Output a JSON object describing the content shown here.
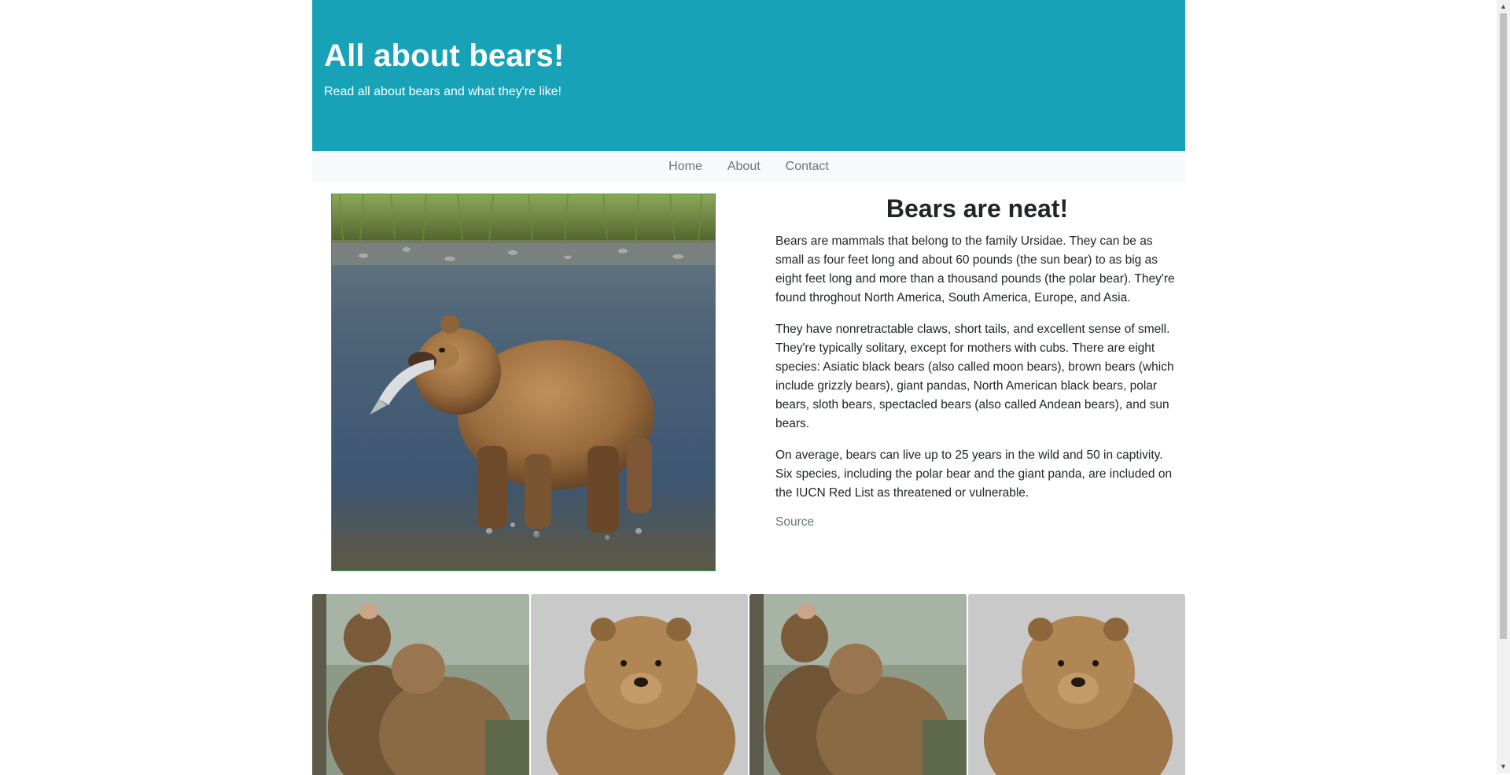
{
  "hero": {
    "title": "All about bears!",
    "subtitle": "Read all about bears and what they're like!"
  },
  "nav": {
    "items": [
      {
        "label": "Home"
      },
      {
        "label": "About"
      },
      {
        "label": "Contact"
      }
    ]
  },
  "main_image": {
    "icon": "bear-with-fish-photo"
  },
  "article": {
    "heading": "Bears are neat!",
    "paragraphs": [
      "Bears are mammals that belong to the family Ursidae. They can be as small as four feet long and about 60 pounds (the sun bear) to as big as eight feet long and more than a thousand pounds (the polar bear). They're found throghout North America, South America, Europe, and Asia.",
      "They have nonretractable claws, short tails, and excellent sense of smell. They're typically solitary, except for mothers with cubs. There are eight species: Asiatic black bears (also called moon bears), brown bears (which include grizzly bears), giant pandas, North American black bears, polar bears, sloth bears, spectacled bears (also called Andean bears), and sun bears.",
      "On average, bears can live up to 25 years in the wild and 50 in captivity. Six species, including the polar bear and the giant panda, are included on the IUCN Red List as threatened or vulnerable."
    ],
    "source_label": "Source"
  },
  "gallery": {
    "items": [
      {
        "icon": "bear-cubs-photo"
      },
      {
        "icon": "brown-bear-photo"
      },
      {
        "icon": "bear-cubs-photo"
      },
      {
        "icon": "brown-bear-photo"
      }
    ]
  },
  "colors": {
    "hero_bg": "#17a2b8",
    "nav_bg": "#f8f9fa",
    "image_border": "#28a745"
  }
}
